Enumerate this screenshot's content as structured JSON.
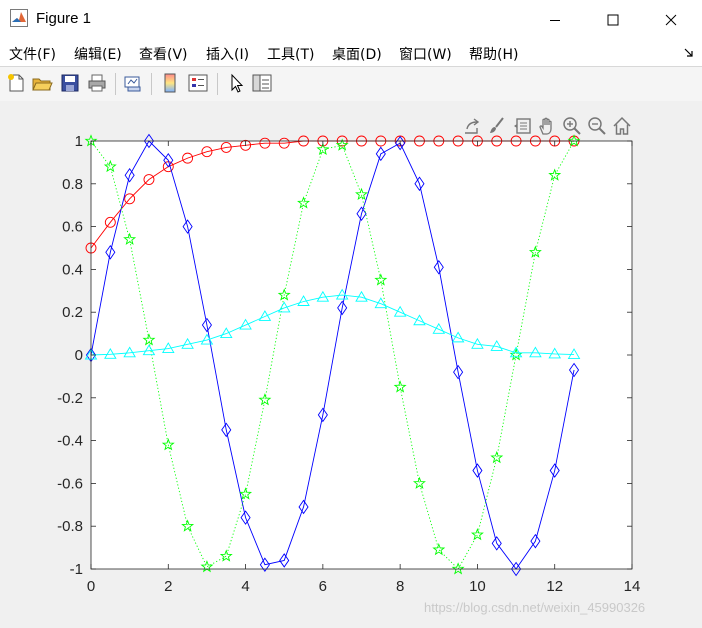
{
  "window": {
    "title": "Figure 1",
    "minimize_icon": "minimize-icon",
    "maximize_icon": "maximize-icon",
    "close_icon": "close-icon"
  },
  "menu": {
    "items": [
      "文件(F)",
      "编辑(E)",
      "查看(V)",
      "插入(I)",
      "工具(T)",
      "桌面(D)",
      "窗口(W)",
      "帮助(H)"
    ]
  },
  "toolbar": {
    "icons": [
      "new-figure-icon",
      "open-file-icon",
      "save-icon",
      "print-icon",
      "link-plot-icon",
      "colorbar-icon",
      "legend-icon",
      "pointer-icon",
      "property-editor-icon"
    ]
  },
  "axes_toolbar": {
    "icons": [
      "export-icon",
      "brush-icon",
      "datatip-icon",
      "pan-icon",
      "zoom-in-icon",
      "zoom-out-icon",
      "home-icon"
    ]
  },
  "watermark": "https://blog.csdn.net/weixin_45990326",
  "chart_data": {
    "type": "line",
    "xlim": [
      0,
      14
    ],
    "ylim": [
      -1,
      1
    ],
    "xticks": [
      "0",
      "2",
      "4",
      "6",
      "8",
      "10",
      "12",
      "14"
    ],
    "yticks": [
      "-1",
      "-0.8",
      "-0.6",
      "-0.4",
      "-0.2",
      "0",
      "0.2",
      "0.4",
      "0.6",
      "0.8",
      "1"
    ],
    "grid": false,
    "x": [
      0,
      0.5,
      1,
      1.5,
      2,
      2.5,
      3,
      3.5,
      4,
      4.5,
      5,
      5.5,
      6,
      6.5,
      7,
      7.5,
      8,
      8.5,
      9,
      9.5,
      10,
      10.5,
      11,
      11.5,
      12,
      12.5
    ],
    "series": [
      {
        "color": "#ff0000",
        "line": "solid",
        "marker": "circle",
        "values": [
          0.5,
          0.62,
          0.73,
          0.82,
          0.88,
          0.92,
          0.95,
          0.97,
          0.98,
          0.99,
          0.99,
          1.0,
          1.0,
          1.0,
          1.0,
          1.0,
          1.0,
          1.0,
          1.0,
          1.0,
          1.0,
          1.0,
          1.0,
          1.0,
          1.0,
          1.0
        ]
      },
      {
        "color": "#0000ff",
        "line": "solid",
        "marker": "diamond",
        "values": [
          0.0,
          0.48,
          0.84,
          1.0,
          0.91,
          0.6,
          0.14,
          -0.35,
          -0.76,
          -0.98,
          -0.96,
          -0.71,
          -0.28,
          0.22,
          0.66,
          0.94,
          0.99,
          0.8,
          0.41,
          -0.08,
          -0.54,
          -0.88,
          -1.0,
          -0.87,
          -0.54,
          -0.07
        ]
      },
      {
        "color": "#00ff00",
        "line": "dotted",
        "marker": "star",
        "values": [
          1.0,
          0.88,
          0.54,
          0.07,
          -0.42,
          -0.8,
          -0.99,
          -0.94,
          -0.65,
          -0.21,
          0.28,
          0.71,
          0.96,
          0.98,
          0.75,
          0.35,
          -0.15,
          -0.6,
          -0.91,
          -1.0,
          -0.84,
          -0.48,
          0.0,
          0.48,
          0.84,
          1.0
        ]
      },
      {
        "color": "#00ffff",
        "line": "solid",
        "marker": "triangle",
        "values": [
          0.0,
          0.003,
          0.01,
          0.02,
          0.03,
          0.05,
          0.07,
          0.1,
          0.14,
          0.18,
          0.22,
          0.25,
          0.27,
          0.28,
          0.27,
          0.24,
          0.2,
          0.16,
          0.12,
          0.08,
          0.05,
          0.04,
          0.01,
          0.01,
          0.005,
          0.002
        ]
      }
    ]
  }
}
